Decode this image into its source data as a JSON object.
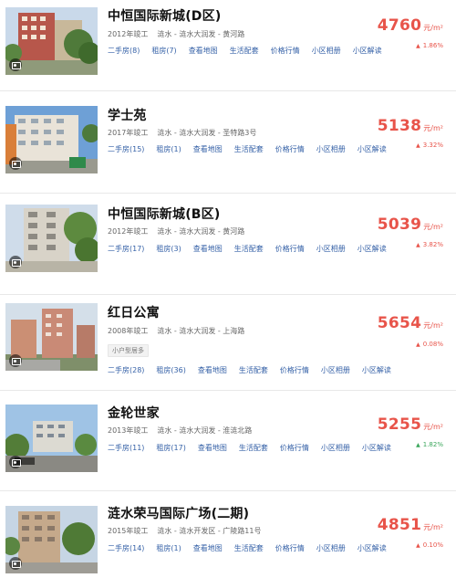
{
  "listings": [
    {
      "name": "中恒国际新城(D区)",
      "info": {
        "year": "2012年竣工",
        "location": "涟水 - 涟水大润发 - 黄河路"
      },
      "tag": "",
      "links": [
        "二手房(8)",
        "租房(7)",
        "查看地图",
        "生活配套",
        "价格行情",
        "小区相册",
        "小区解读"
      ],
      "price": "4760",
      "unit": "元/m²",
      "change": "1.86%",
      "trend": "up"
    },
    {
      "name": "学士苑",
      "info": {
        "year": "2017年竣工",
        "location": "涟水 - 涟水大润发 - 圣特路3号"
      },
      "tag": "",
      "links": [
        "二手房(15)",
        "租房(1)",
        "查看地图",
        "生活配套",
        "价格行情",
        "小区相册",
        "小区解读"
      ],
      "price": "5138",
      "unit": "元/m²",
      "change": "3.32%",
      "trend": "up"
    },
    {
      "name": "中恒国际新城(B区)",
      "info": {
        "year": "2012年竣工",
        "location": "涟水 - 涟水大润发 - 黄河路"
      },
      "tag": "",
      "links": [
        "二手房(17)",
        "租房(3)",
        "查看地图",
        "生活配套",
        "价格行情",
        "小区相册",
        "小区解读"
      ],
      "price": "5039",
      "unit": "元/m²",
      "change": "3.82%",
      "trend": "up"
    },
    {
      "name": "红日公寓",
      "info": {
        "year": "2008年竣工",
        "location": "涟水 - 涟水大润发 - 上海路"
      },
      "tag": "小户型居多",
      "links": [
        "二手房(28)",
        "租房(36)",
        "查看地图",
        "生活配套",
        "价格行情",
        "小区相册",
        "小区解读"
      ],
      "price": "5654",
      "unit": "元/m²",
      "change": "0.08%",
      "trend": "up"
    },
    {
      "name": "金轮世家",
      "info": {
        "year": "2013年竣工",
        "location": "涟水 - 涟水大润发 - 淮涟北路"
      },
      "tag": "",
      "links": [
        "二手房(11)",
        "租房(17)",
        "查看地图",
        "生活配套",
        "价格行情",
        "小区相册",
        "小区解读"
      ],
      "price": "5255",
      "unit": "元/m²",
      "change": "1.82%",
      "trend": "down"
    },
    {
      "name": "涟水荣马国际广场(二期)",
      "info": {
        "year": "2015年竣工",
        "location": "涟水 - 涟水开发区 - 广陵路11号"
      },
      "tag": "",
      "links": [
        "二手房(14)",
        "租房(1)",
        "查看地图",
        "生活配套",
        "价格行情",
        "小区相册",
        "小区解读"
      ],
      "price": "4851",
      "unit": "元/m²",
      "change": "0.10%",
      "trend": "up"
    }
  ],
  "trend_symbols": {
    "up": "▲",
    "down": "▲"
  },
  "colors": {
    "price": "#e8544a",
    "link": "#3561a7",
    "rise": "#e8544a",
    "fall": "#3aa65b"
  }
}
